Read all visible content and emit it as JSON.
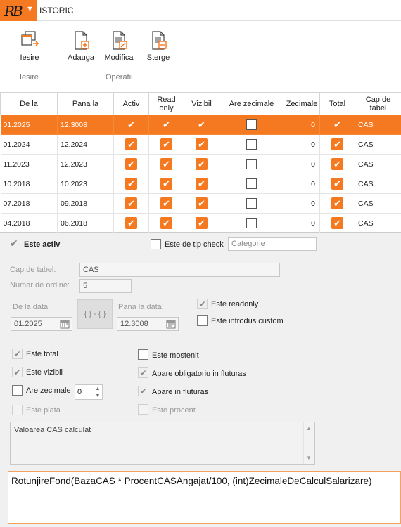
{
  "app": {
    "logo": "RB",
    "menu_tab": "ISTORIC"
  },
  "ribbon": {
    "groups": [
      {
        "label": "Iesire",
        "buttons": [
          {
            "label": "Iesire",
            "icon": "exit-icon"
          }
        ]
      },
      {
        "label": "Operatii",
        "buttons": [
          {
            "label": "Adauga",
            "icon": "add-document-icon"
          },
          {
            "label": "Modifica",
            "icon": "edit-document-icon"
          },
          {
            "label": "Sterge",
            "icon": "delete-document-icon"
          }
        ]
      }
    ]
  },
  "grid": {
    "columns": [
      "De la",
      "Pana la",
      "Activ",
      "Read only",
      "Vizibil",
      "Are zecimale",
      "Zecimale",
      "Total",
      "Cap de tabel"
    ],
    "rows": [
      {
        "de_la": "01.2025",
        "pana_la": "12.3008",
        "activ": true,
        "read_only": true,
        "vizibil": true,
        "are_zecimale": false,
        "zecimale": "0",
        "total": true,
        "cap": "CAS",
        "selected": true
      },
      {
        "de_la": "01.2024",
        "pana_la": "12.2024",
        "activ": true,
        "read_only": true,
        "vizibil": true,
        "are_zecimale": false,
        "zecimale": "0",
        "total": true,
        "cap": "CAS",
        "selected": false
      },
      {
        "de_la": "11.2023",
        "pana_la": "12.2023",
        "activ": true,
        "read_only": true,
        "vizibil": true,
        "are_zecimale": false,
        "zecimale": "0",
        "total": true,
        "cap": "CAS",
        "selected": false
      },
      {
        "de_la": "10.2018",
        "pana_la": "10.2023",
        "activ": true,
        "read_only": true,
        "vizibil": true,
        "are_zecimale": false,
        "zecimale": "0",
        "total": true,
        "cap": "CAS",
        "selected": false
      },
      {
        "de_la": "07.2018",
        "pana_la": "09.2018",
        "activ": true,
        "read_only": true,
        "vizibil": true,
        "are_zecimale": false,
        "zecimale": "0",
        "total": true,
        "cap": "CAS",
        "selected": false
      },
      {
        "de_la": "04.2018",
        "pana_la": "06.2018",
        "activ": true,
        "read_only": true,
        "vizibil": true,
        "are_zecimale": false,
        "zecimale": "0",
        "total": true,
        "cap": "CAS",
        "selected": false
      }
    ]
  },
  "form": {
    "este_activ": {
      "label": "Este activ",
      "checked": true
    },
    "este_tip_check": {
      "label": "Este de tip check",
      "checked": false
    },
    "categorie_placeholder": "Categorie",
    "cap_tabel": {
      "label": "Cap de tabel:",
      "value": "CAS"
    },
    "numar_ordine": {
      "label": "Numar de ordine:",
      "value": "5"
    },
    "de_la_data": {
      "label": "De la data",
      "value": "01.2025"
    },
    "range_button": "{ } - { }",
    "pana_la_data": {
      "label": "Pana la data:",
      "value": "12.3008"
    },
    "este_readonly": {
      "label": "Este readonly",
      "checked": true
    },
    "este_custom": {
      "label": "Este introdus custom",
      "checked": false
    },
    "este_total": {
      "label": "Este total",
      "checked": true
    },
    "este_vizibil": {
      "label": "Este vizibil",
      "checked": true
    },
    "are_zecimale": {
      "label": "Are zecimale",
      "checked": false,
      "value": "0"
    },
    "este_plata": {
      "label": "Este plata",
      "checked": false
    },
    "este_mostenit": {
      "label": "Este mostenit",
      "checked": false
    },
    "apare_obligatoriu": {
      "label": "Apare obligatoriu in fluturas",
      "checked": true
    },
    "apare_fluturas": {
      "label": "Apare in fluturas",
      "checked": true
    },
    "este_procent": {
      "label": "Este procent",
      "checked": false
    },
    "descriere": "Valoarea CAS calculat",
    "formula": "RotunjireFond(BazaCAS * ProcentCASAngajat/100, (int)ZecimaleDeCalculSalarizare)"
  },
  "colors": {
    "accent": "#f47920",
    "selected_row": "#f47920"
  }
}
